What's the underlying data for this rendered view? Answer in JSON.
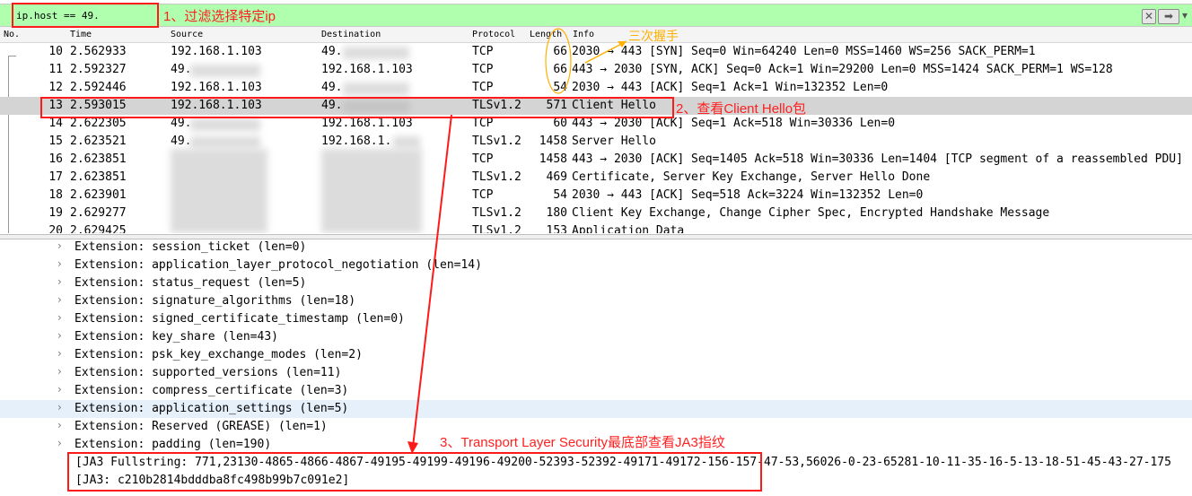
{
  "filter": {
    "text": "ip.host == 49.",
    "clear_icon": "x-icon",
    "apply_icon": "arrow-right-icon"
  },
  "columns": [
    "No.",
    "Time",
    "Source",
    "Destination",
    "Protocol",
    "Length",
    "Info"
  ],
  "packets": [
    {
      "no": "10",
      "time": "2.562933",
      "src": "192.168.1.103",
      "dst": "49.",
      "proto": "TCP",
      "len": "66",
      "info": "2030 → 443 [SYN] Seq=0 Win=64240 Len=0 MSS=1460 WS=256 SACK_PERM=1"
    },
    {
      "no": "11",
      "time": "2.592327",
      "src": "49.",
      "dst": "192.168.1.103",
      "proto": "TCP",
      "len": "66",
      "info": "443 → 2030 [SYN, ACK] Seq=0 Ack=1 Win=29200 Len=0 MSS=1424 SACK_PERM=1 WS=128"
    },
    {
      "no": "12",
      "time": "2.592446",
      "src": "192.168.1.103",
      "dst": "49.",
      "proto": "TCP",
      "len": "54",
      "info": "2030 → 443 [ACK] Seq=1 Ack=1 Win=132352 Len=0"
    },
    {
      "no": "13",
      "time": "2.593015",
      "src": "192.168.1.103",
      "dst": "49.",
      "proto": "TLSv1.2",
      "len": "571",
      "info": "Client Hello"
    },
    {
      "no": "14",
      "time": "2.622305",
      "src": "49.",
      "dst": "192.168.1.103",
      "proto": "TCP",
      "len": "60",
      "info": "443 → 2030 [ACK] Seq=1 Ack=518 Win=30336 Len=0"
    },
    {
      "no": "15",
      "time": "2.623521",
      "src": "49.",
      "dst": "192.168.1.",
      "proto": "TLSv1.2",
      "len": "1458",
      "info": "Server Hello"
    },
    {
      "no": "16",
      "time": "2.623851",
      "src": "",
      "dst": "",
      "proto": "TCP",
      "len": "1458",
      "info": "443 → 2030 [ACK] Seq=1405 Ack=518 Win=30336 Len=1404 [TCP segment of a reassembled PDU]"
    },
    {
      "no": "17",
      "time": "2.623851",
      "src": "",
      "dst": "",
      "proto": "TLSv1.2",
      "len": "469",
      "info": "Certificate, Server Key Exchange, Server Hello Done"
    },
    {
      "no": "18",
      "time": "2.623901",
      "src": "",
      "dst": "",
      "proto": "TCP",
      "len": "54",
      "info": "2030 → 443 [ACK] Seq=518 Ack=3224 Win=132352 Len=0"
    },
    {
      "no": "19",
      "time": "2.629277",
      "src": "",
      "dst": "",
      "proto": "TLSv1.2",
      "len": "180",
      "info": "Client Key Exchange, Change Cipher Spec, Encrypted Handshake Message"
    },
    {
      "no": "20",
      "time": "2.629425",
      "src": "",
      "dst": "",
      "proto": "TLSv1.2",
      "len": "153",
      "info": "Application Data"
    }
  ],
  "details": [
    {
      "text": "Extension: session_ticket (len=0)",
      "expandable": true
    },
    {
      "text": "Extension: application_layer_protocol_negotiation (len=14)",
      "expandable": true
    },
    {
      "text": "Extension: status_request (len=5)",
      "expandable": true
    },
    {
      "text": "Extension: signature_algorithms (len=18)",
      "expandable": true
    },
    {
      "text": "Extension: signed_certificate_timestamp (len=0)",
      "expandable": true
    },
    {
      "text": "Extension: key_share (len=43)",
      "expandable": true
    },
    {
      "text": "Extension: psk_key_exchange_modes (len=2)",
      "expandable": true
    },
    {
      "text": "Extension: supported_versions (len=11)",
      "expandable": true
    },
    {
      "text": "Extension: compress_certificate (len=3)",
      "expandable": true
    },
    {
      "text": "Extension: application_settings (len=5)",
      "expandable": true
    },
    {
      "text": "Extension: Reserved (GREASE) (len=1)",
      "expandable": true
    },
    {
      "text": "Extension: padding (len=190)",
      "expandable": true
    },
    {
      "text": "[JA3 Fullstring: 771,23130-4865-4866-4867-49195-49199-49196-49200-52393-52392-49171-49172-156-157-47-53,56026-0-23-65281-10-11-35-16-5-13-18-51-45-43-27-175",
      "expandable": false
    },
    {
      "text": "[JA3: c210b2814bdddba8fc498b99b7c091e2]",
      "expandable": false
    }
  ],
  "annotations": {
    "a1": "1、过滤选择特定ip",
    "a2": "2、查看Client Hello包",
    "a3": "3、Transport Layer Security最底部查看JA3指纹",
    "handshake": "三次握手"
  },
  "colors": {
    "filter_bg": "#afffaf",
    "annotation_red": "#ff2020",
    "annotation_orange": "#ffb000",
    "selected_row": "#d4d4d4"
  }
}
